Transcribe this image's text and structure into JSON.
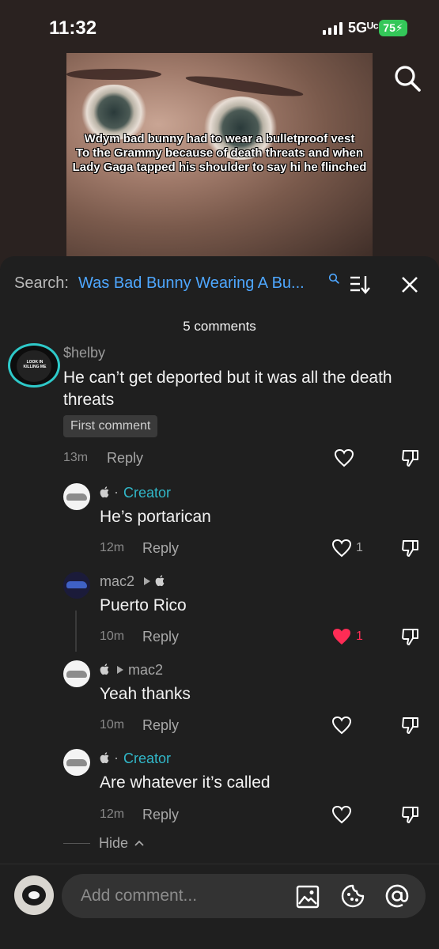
{
  "status_bar": {
    "time": "11:32",
    "network": "5Gᵁᶜ",
    "battery": "75"
  },
  "video": {
    "caption_lines": [
      "Wdym bad bunny had to wear a bulletproof vest",
      "To the Grammy because of death threats and when",
      "Lady Gaga tapped his shoulder to say hi he flinched"
    ]
  },
  "comments_header": {
    "search_label": "Search:",
    "search_query": "Was Bad Bunny Wearing A Bu...",
    "count_text": "5 comments"
  },
  "main_comment": {
    "username": "$helby",
    "text": "He can’t get deported but it was all the death threats",
    "badge": "First comment",
    "time": "13m",
    "reply_label": "Reply",
    "avatar_text": "LOOK IN KILLING ME"
  },
  "replies": [
    {
      "author_label": "Creator",
      "text": "He’s portarican",
      "time": "12m",
      "reply_label": "Reply",
      "likes": "1"
    },
    {
      "author_name": "mac2",
      "text": "Puerto Rico",
      "time": "10m",
      "reply_label": "Reply",
      "likes": "1"
    },
    {
      "target_name": "mac2",
      "text": "Yeah thanks",
      "time": "10m",
      "reply_label": "Reply"
    },
    {
      "author_label": "Creator",
      "text": "Are whatever it’s called",
      "time": "12m",
      "reply_label": "Reply"
    }
  ],
  "hide_label": "Hide",
  "composer": {
    "placeholder": "Add comment..."
  },
  "colors": {
    "accent_link": "#4ea7ff",
    "creator": "#31b7c8",
    "liked_heart": "#fe2c55",
    "story_ring": "#2ec9c9",
    "battery": "#34c759"
  }
}
